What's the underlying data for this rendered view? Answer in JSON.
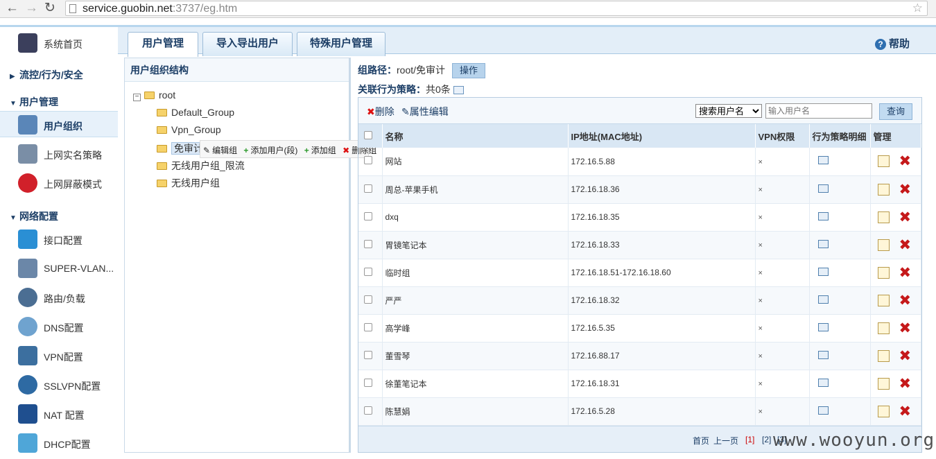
{
  "browser": {
    "url_host": "service.guobin.net",
    "url_rest": ":3737/eg.htm"
  },
  "sidebar": {
    "home": "系统首页",
    "sec_flow": "流控/行为/安全",
    "sec_user": "用户管理",
    "user_group": "用户组织",
    "realname": "上网实名策略",
    "block": "上网屏蔽模式",
    "sec_net": "网络配置",
    "items": [
      "接口配置",
      "SUPER-VLAN...",
      "路由/负载",
      "DNS配置",
      "VPN配置",
      "SSLVPN配置",
      "NAT 配置",
      "DHCP配置"
    ]
  },
  "tabs": [
    "用户管理",
    "导入导出用户",
    "特殊用户管理"
  ],
  "help": "帮助",
  "tree": {
    "header": "用户组织结构",
    "root": "root",
    "nodes": [
      "Default_Group",
      "Vpn_Group",
      "免审计",
      "无线用户组_限流",
      "无线用户组"
    ],
    "menu": {
      "edit": "编辑组",
      "add_user": "添加用户(段)",
      "add_group": "添加组",
      "del_group": "删除组"
    }
  },
  "path": {
    "label": "组路径：",
    "value": "root/免审计",
    "op": "操作",
    "assoc_label": "关联行为策略：",
    "assoc_value": "共0条"
  },
  "toolbar": {
    "delete": "删除",
    "prop_edit": "属性编辑",
    "search_select": "搜索用户名",
    "search_placeholder": "输入用户名",
    "query": "查询"
  },
  "columns": [
    "名称",
    "IP地址(MAC地址)",
    "VPN权限",
    "行为策略明细",
    "管理"
  ],
  "rows": [
    {
      "name": "网站",
      "ip": "172.16.5.88",
      "vpn": "×"
    },
    {
      "name": "周总-苹果手机",
      "ip": "172.16.18.36",
      "vpn": "×"
    },
    {
      "name": "dxq",
      "ip": "172.16.18.35",
      "vpn": "×"
    },
    {
      "name": "胃镜笔记本",
      "ip": "172.16.18.33",
      "vpn": "×"
    },
    {
      "name": "临时组",
      "ip": "172.16.18.51-172.16.18.60",
      "vpn": "×"
    },
    {
      "name": "严严",
      "ip": "172.16.18.32",
      "vpn": "×"
    },
    {
      "name": "高学峰",
      "ip": "172.16.5.35",
      "vpn": "×"
    },
    {
      "name": "董雪琴",
      "ip": "172.16.88.17",
      "vpn": "×"
    },
    {
      "name": "徐董笔记本",
      "ip": "172.16.18.31",
      "vpn": "×"
    },
    {
      "name": "陈慧娟",
      "ip": "172.16.5.28",
      "vpn": "×"
    }
  ],
  "pager": {
    "first": "首页",
    "prev": "上一页",
    "p1": "[1]",
    "p2": "[2]",
    "p3": "[3]"
  },
  "watermark": "www.wooyun.org"
}
